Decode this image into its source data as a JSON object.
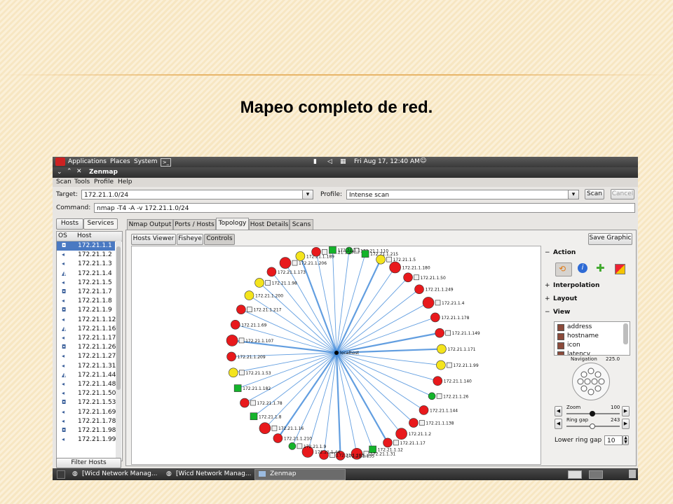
{
  "slide": {
    "title": "Mapeo completo de red."
  },
  "panel": {
    "applications": "Applications",
    "places": "Places",
    "system": "System",
    "clock": "Fri Aug 17, 12:40 AM"
  },
  "window": {
    "title": "Zenmap"
  },
  "menu": [
    "Scan",
    "Tools",
    "Profile",
    "Help"
  ],
  "toolbar": {
    "target_label": "Target:",
    "target_value": "172.21.1.0/24",
    "profile_label": "Profile:",
    "profile_value": "Intense scan",
    "scan_label": "Scan",
    "cancel_label": "Cancel",
    "command_label": "Command:",
    "command_value": "nmap -T4 -A -v 172.21.1.0/24"
  },
  "left": {
    "tab_hosts": "Hosts",
    "tab_services": "Services",
    "col_os": "OS",
    "col_host": "Host",
    "hosts": [
      "172.21.1.1",
      "172.21.1.2",
      "172.21.1.3",
      "172.21.1.4",
      "172.21.1.5",
      "172.21.1.7",
      "172.21.1.8",
      "172.21.1.9",
      "172.21.1.12",
      "172.21.1.16",
      "172.21.1.17",
      "172.21.1.26",
      "172.21.1.27",
      "172.21.1.31",
      "172.21.1.44",
      "172.21.1.48",
      "172.21.1.50",
      "172.21.1.53",
      "172.21.1.69",
      "172.21.1.78",
      "172.21.1.98",
      "172.21.1.99"
    ],
    "filter_label": "Filter Hosts"
  },
  "tabs": [
    "Nmap Output",
    "Ports / Hosts",
    "Topology",
    "Host Details",
    "Scans"
  ],
  "topology_toolbar": {
    "hosts_viewer": "Hosts Viewer",
    "fisheye": "Fisheye",
    "controls": "Controls",
    "save_graphic": "Save Graphic"
  },
  "graph": {
    "center_label": "localhost",
    "nodes": [
      {
        "label": "172.21.1.110",
        "color": "green"
      },
      {
        "label": "172.21.1.215",
        "color": "green"
      },
      {
        "label": "172.21.1.5",
        "color": "yellow"
      },
      {
        "label": "172.21.1.180",
        "color": "red"
      },
      {
        "label": "172.21.1.50",
        "color": "red"
      },
      {
        "label": "172.21.1.249",
        "color": "red"
      },
      {
        "label": "172.21.1.4",
        "color": "red"
      },
      {
        "label": "172.21.1.178",
        "color": "red"
      },
      {
        "label": "172.21.1.149",
        "color": "red"
      },
      {
        "label": "172.21.1.171",
        "color": "yellow"
      },
      {
        "label": "172.21.1.99",
        "color": "yellow"
      },
      {
        "label": "172.21.1.140",
        "color": "red"
      },
      {
        "label": "172.21.1.26",
        "color": "green"
      },
      {
        "label": "172.21.1.144",
        "color": "red"
      },
      {
        "label": "172.21.1.138",
        "color": "red"
      },
      {
        "label": "172.21.1.2",
        "color": "red"
      },
      {
        "label": "172.21.1.17",
        "color": "red"
      },
      {
        "label": "172.21.1.12",
        "color": "green"
      },
      {
        "label": "172.21.1.31",
        "color": "red"
      },
      {
        "label": "172.21.1.155",
        "color": "red"
      },
      {
        "label": "172.21.1.185",
        "color": "red"
      },
      {
        "label": "172.21.1.44",
        "color": "red"
      },
      {
        "label": "172.21.1.9",
        "color": "green"
      },
      {
        "label": "172.21.1.210",
        "color": "red"
      },
      {
        "label": "172.21.1.16",
        "color": "red"
      },
      {
        "label": "172.21.1.8",
        "color": "green"
      },
      {
        "label": "172.21.1.78",
        "color": "red"
      },
      {
        "label": "172.21.1.182",
        "color": "green"
      },
      {
        "label": "172.21.1.53",
        "color": "yellow"
      },
      {
        "label": "172.21.1.209",
        "color": "red"
      },
      {
        "label": "172.21.1.107",
        "color": "red"
      },
      {
        "label": "172.21.1.69",
        "color": "red"
      },
      {
        "label": "172.21.1.217",
        "color": "red"
      },
      {
        "label": "172.21.1.200",
        "color": "yellow"
      },
      {
        "label": "172.21.1.98",
        "color": "yellow"
      },
      {
        "label": "172.21.1.173",
        "color": "red"
      },
      {
        "label": "172.21.1.206",
        "color": "red"
      },
      {
        "label": "172.21.1.189",
        "color": "yellow"
      },
      {
        "label": "172.21.1.27",
        "color": "red"
      },
      {
        "label": "172.21.1.1",
        "color": "green"
      }
    ]
  },
  "sidebar": {
    "action": "Action",
    "interpolation": "Interpolation",
    "layout": "Layout",
    "view": "View",
    "view_options": [
      "address",
      "hostname",
      "icon",
      "latency"
    ],
    "navigation_label": "Navigation",
    "navigation_value": "225.0",
    "zoom_label": "Zoom",
    "zoom_value": "100",
    "ring_gap_label": "Ring gap",
    "ring_gap_value": "243",
    "lower_ring_gap_label": "Lower ring gap",
    "lower_ring_gap_value": "10"
  },
  "taskbar": {
    "item1": "[Wicd Network Manag...",
    "item2": "[Wicd Network Manag...",
    "item3": "Zenmap"
  },
  "colors": {
    "red": "#e8191c",
    "yellow": "#f4e41d",
    "green": "#14b42b",
    "edge": "#3b86d8"
  }
}
